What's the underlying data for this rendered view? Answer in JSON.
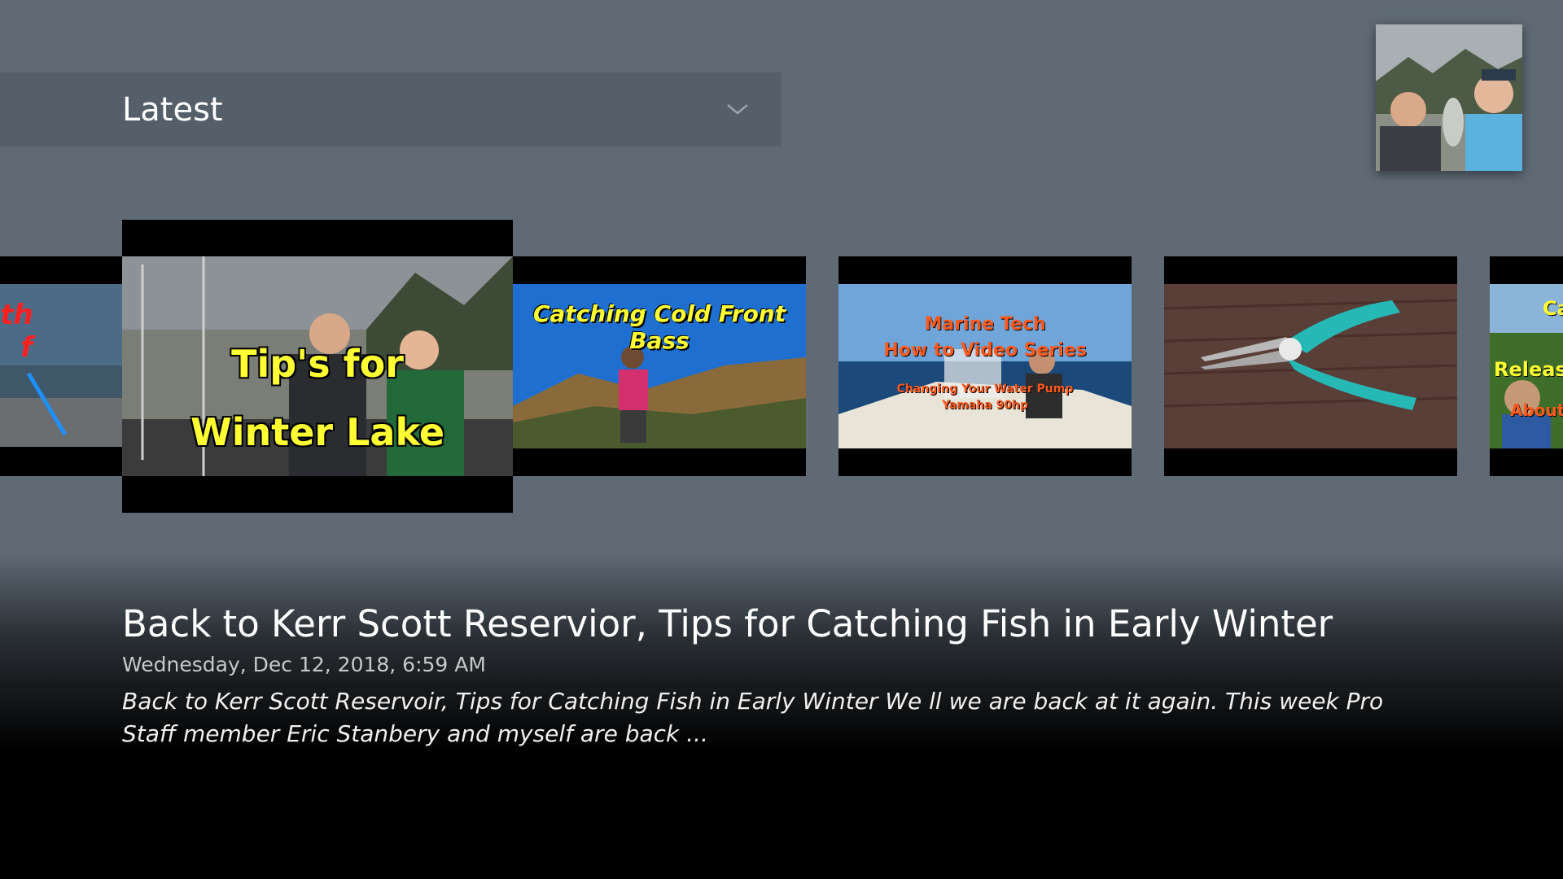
{
  "dropdown": {
    "label": "Latest",
    "icon": "chevron-down-icon"
  },
  "channel_avatar": {
    "icon": "channel-avatar"
  },
  "videos": [
    {
      "thumb_text_lines": [
        "neath",
        "f"
      ]
    },
    {
      "thumb_text_lines": [
        "Tip's for",
        "Winter Lake Fishing"
      ]
    },
    {
      "thumb_text_lines": [
        "Catching Cold Front Bass"
      ]
    },
    {
      "thumb_text_lines": [
        "Marine Tech",
        "How to Video Series",
        "Changing Your Water Pump",
        "Yamaha 90hp"
      ]
    },
    {
      "thumb_text_lines": []
    },
    {
      "thumb_text_lines": [
        "Ca",
        "Releas",
        "About ou"
      ]
    }
  ],
  "selected": {
    "title": "Back to Kerr Scott Reservior, Tips for Catching Fish in Early Winter",
    "date": "Wednesday, Dec 12, 2018, 6:59 AM",
    "description": "Back to Kerr Scott Reservoir, Tips for Catching Fish in Early Winter We ll we are back at it again. This week Pro Staff member Eric Stanbery and myself are back ..."
  },
  "colors": {
    "background": "#5f6a75",
    "dropdown_bg": "#545f6a",
    "thumb_yellow": "#ffff33",
    "thumb_orange": "#ff5a1f",
    "thumb_red": "#ff2020"
  }
}
